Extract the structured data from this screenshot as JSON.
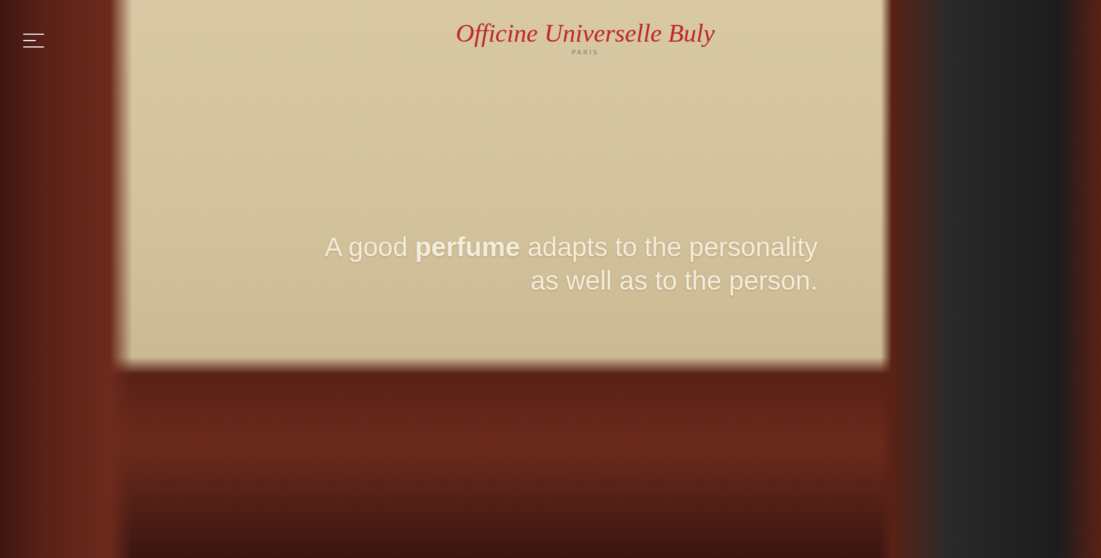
{
  "header": {
    "menu_button": {
      "label": "Menu"
    },
    "logo": {
      "name": "Officine Universelle Buly",
      "city": "PARIS"
    }
  },
  "hero": {
    "photo": {
      "subject": "perfume shelves"
    },
    "tagline": [
      [
        {
          "text": "A good ",
          "bold": false
        },
        {
          "text": "perfume",
          "bold": true
        },
        {
          "text": " adapts to the personality",
          "bold": false
        }
      ],
      [
        {
          "text": "as well as to the person.",
          "bold": false
        }
      ]
    ]
  }
}
